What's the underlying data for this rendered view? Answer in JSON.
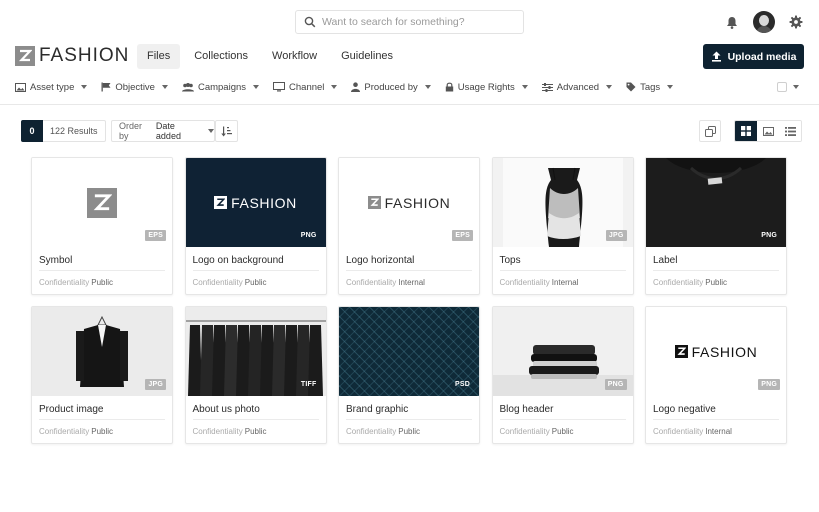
{
  "search": {
    "placeholder": "Want to search for something?"
  },
  "brand": {
    "name": "FASHION"
  },
  "nav": {
    "tabs": [
      {
        "label": "Files",
        "active": true
      },
      {
        "label": "Collections",
        "active": false
      },
      {
        "label": "Workflow",
        "active": false
      },
      {
        "label": "Guidelines",
        "active": false
      }
    ]
  },
  "upload": {
    "label": "Upload media"
  },
  "filters": [
    {
      "label": "Asset type",
      "icon": "image-icon"
    },
    {
      "label": "Objective",
      "icon": "flag-icon"
    },
    {
      "label": "Campaigns",
      "icon": "users-icon"
    },
    {
      "label": "Channel",
      "icon": "monitor-icon"
    },
    {
      "label": "Produced by",
      "icon": "user-icon"
    },
    {
      "label": "Usage Rights",
      "icon": "lock-icon"
    },
    {
      "label": "Advanced",
      "icon": "sliders-icon"
    },
    {
      "label": "Tags",
      "icon": "tag-icon"
    }
  ],
  "toolbar": {
    "selected_count": "0",
    "results": "122 Results",
    "order_prefix": "Order by",
    "order_value": "Date added"
  },
  "assets": [
    {
      "title": "Symbol",
      "format": "EPS",
      "meta_label": "Confidentiality",
      "meta_value": "Public"
    },
    {
      "title": "Logo on background",
      "format": "PNG",
      "meta_label": "Confidentiality",
      "meta_value": "Public",
      "logo_text": "FASHION"
    },
    {
      "title": "Logo horizontal",
      "format": "EPS",
      "meta_label": "Confidentiality",
      "meta_value": "Internal",
      "logo_text": "FASHION"
    },
    {
      "title": "Tops",
      "format": "JPG",
      "meta_label": "Confidentiality",
      "meta_value": "Internal"
    },
    {
      "title": "Label",
      "format": "PNG",
      "meta_label": "Confidentiality",
      "meta_value": "Public"
    },
    {
      "title": "Product image",
      "format": "JPG",
      "meta_label": "Confidentiality",
      "meta_value": "Public"
    },
    {
      "title": "About us photo",
      "format": "TIFF",
      "meta_label": "Confidentiality",
      "meta_value": "Public"
    },
    {
      "title": "Brand graphic",
      "format": "PSD",
      "meta_label": "Confidentiality",
      "meta_value": "Public"
    },
    {
      "title": "Blog header",
      "format": "PNG",
      "meta_label": "Confidentiality",
      "meta_value": "Public"
    },
    {
      "title": "Logo negative",
      "format": "PNG",
      "meta_label": "Confidentiality",
      "meta_value": "Internal",
      "logo_text": "FASHION"
    }
  ],
  "colors": {
    "navy": "#0e2231",
    "logo_grey": "#8c8c8c"
  }
}
